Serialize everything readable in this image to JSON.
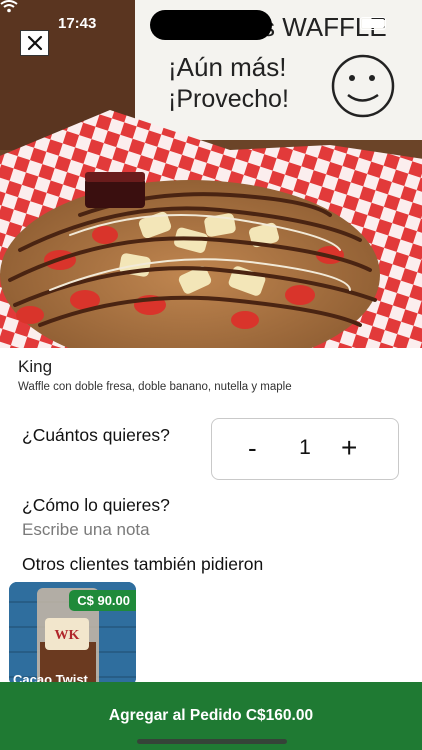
{
  "status": {
    "time": "17:43"
  },
  "hero": {
    "sign_lines": [
      "s WAFFLE",
      "¡Aún más!",
      "¡Provecho!"
    ],
    "accent": "#e52b2b"
  },
  "product": {
    "name": "King",
    "description": "Waffle con doble fresa, doble banano, nutella y maple"
  },
  "quantity": {
    "label": "¿Cuántos quieres?",
    "minus": "-",
    "value": "1",
    "plus": "+"
  },
  "note": {
    "label": "¿Cómo lo quieres?",
    "placeholder": "Escribe una nota"
  },
  "others": {
    "title": "Otros clientes también pidieron",
    "items": [
      {
        "price": "C$ 90.00",
        "name": "Cacao Twist",
        "logo_text": "WK"
      }
    ]
  },
  "cta": {
    "label": "Agregar al Pedido C$160.00",
    "color": "#1f7a33"
  }
}
